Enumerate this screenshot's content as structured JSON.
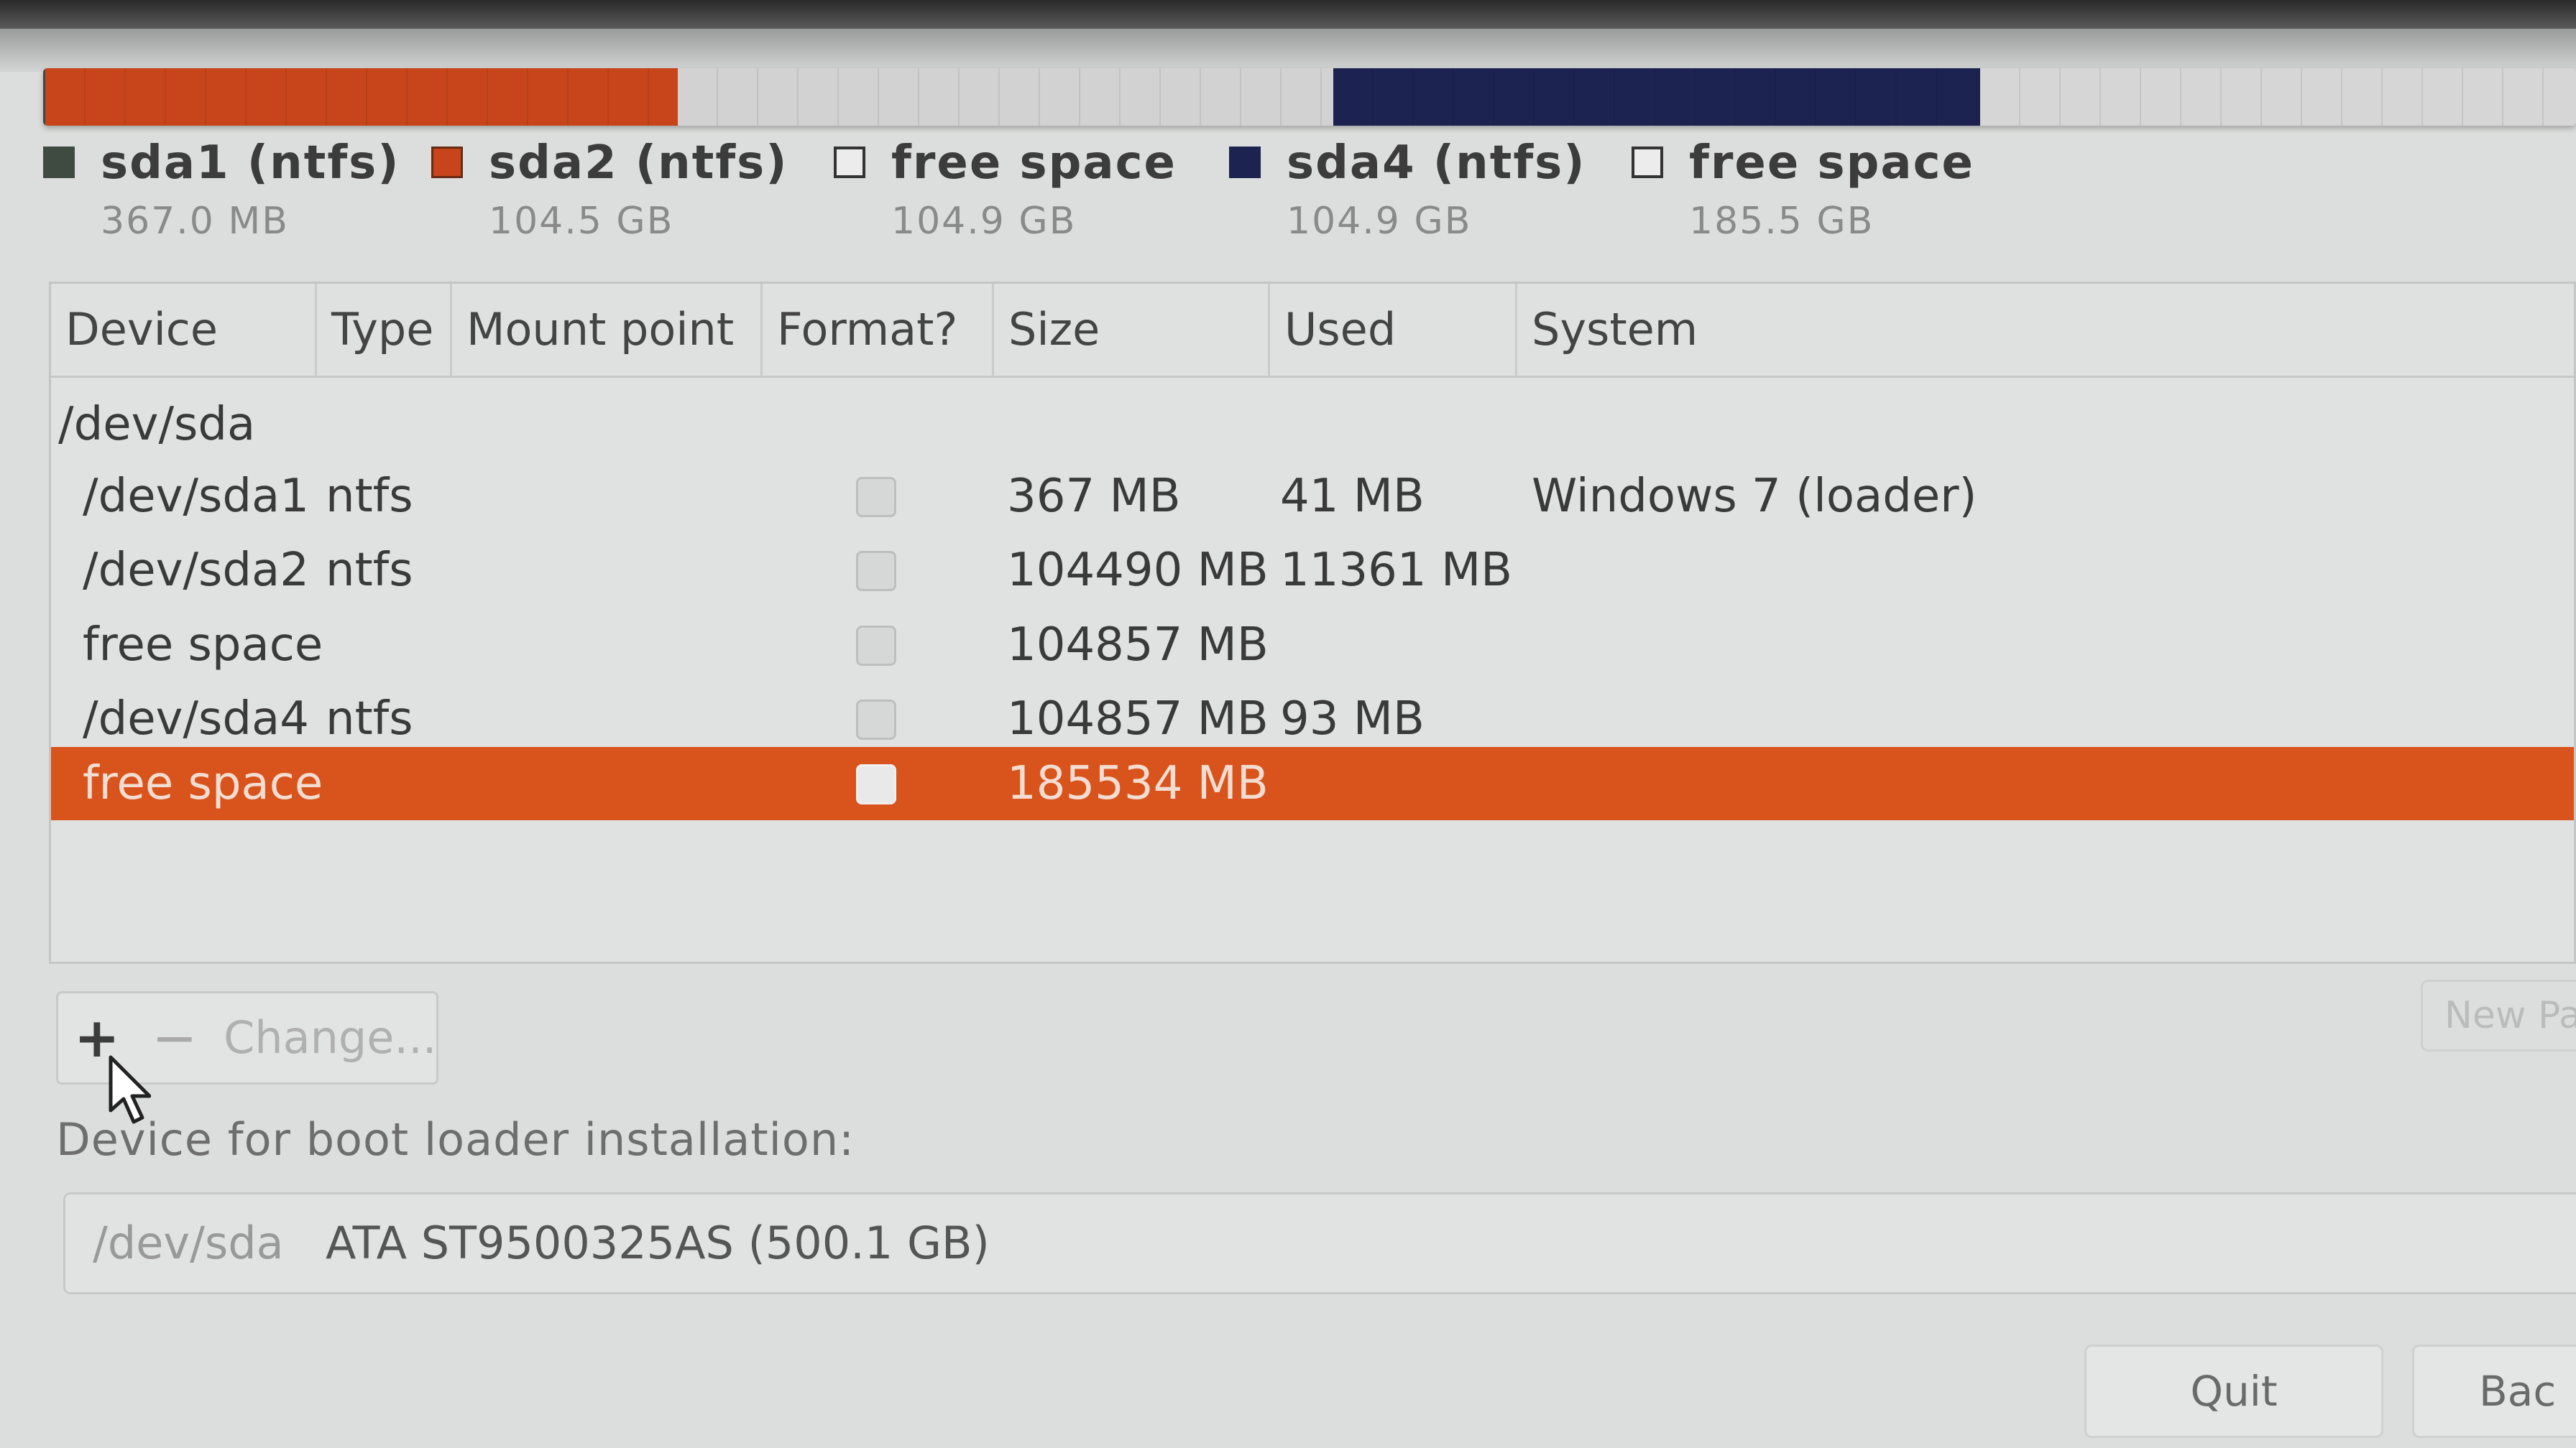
{
  "partition_bar": {
    "segments": [
      {
        "name": "sda1",
        "color": "#3f4a41"
      },
      {
        "name": "sda2",
        "color": "#c8451b"
      },
      {
        "name": "free space",
        "color": "#d2d2d2"
      },
      {
        "name": "sda4",
        "color": "#1d2350"
      },
      {
        "name": "free space",
        "color": "#d6d6d6"
      }
    ]
  },
  "legend": [
    {
      "name": "sda1 (ntfs)",
      "size": "367.0 MB",
      "color": "#3f4a41"
    },
    {
      "name": "sda2 (ntfs)",
      "size": "104.5 GB",
      "color": "#c8451b"
    },
    {
      "name": "free space",
      "size": "104.9 GB",
      "color": "#ffffff"
    },
    {
      "name": "sda4 (ntfs)",
      "size": "104.9 GB",
      "color": "#1d2350"
    },
    {
      "name": "free space",
      "size": "185.5 GB",
      "color": "#ffffff"
    }
  ],
  "table": {
    "headers": {
      "device": "Device",
      "type": "Type",
      "mount": "Mount point",
      "format": "Format?",
      "size": "Size",
      "used": "Used",
      "system": "System"
    },
    "disk": "/dev/sda",
    "rows": [
      {
        "device": "/dev/sda1",
        "type": "ntfs",
        "size": "367 MB",
        "used": "41 MB",
        "system": "Windows 7 (loader)",
        "format": false
      },
      {
        "device": "/dev/sda2",
        "type": "ntfs",
        "size": "104490 MB",
        "used": "11361 MB",
        "system": "",
        "format": false
      },
      {
        "device": "free space",
        "type": "",
        "size": "104857 MB",
        "used": "",
        "system": "",
        "format": false
      },
      {
        "device": "/dev/sda4",
        "type": "ntfs",
        "size": "104857 MB",
        "used": "93 MB",
        "system": "",
        "format": false
      },
      {
        "device": "free space",
        "type": "",
        "size": "185534 MB",
        "used": "",
        "system": "",
        "format": false,
        "selected": true
      }
    ],
    "selection_color": "#d9541c"
  },
  "buttons": {
    "add": "+",
    "remove": "−",
    "change": "Change...",
    "new_partition_table": "New Pa",
    "quit": "Quit",
    "back": "Bac"
  },
  "boot": {
    "label": "Device for boot loader installation:",
    "device": "/dev/sda",
    "model": "ATA ST9500325AS (500.1 GB)"
  }
}
